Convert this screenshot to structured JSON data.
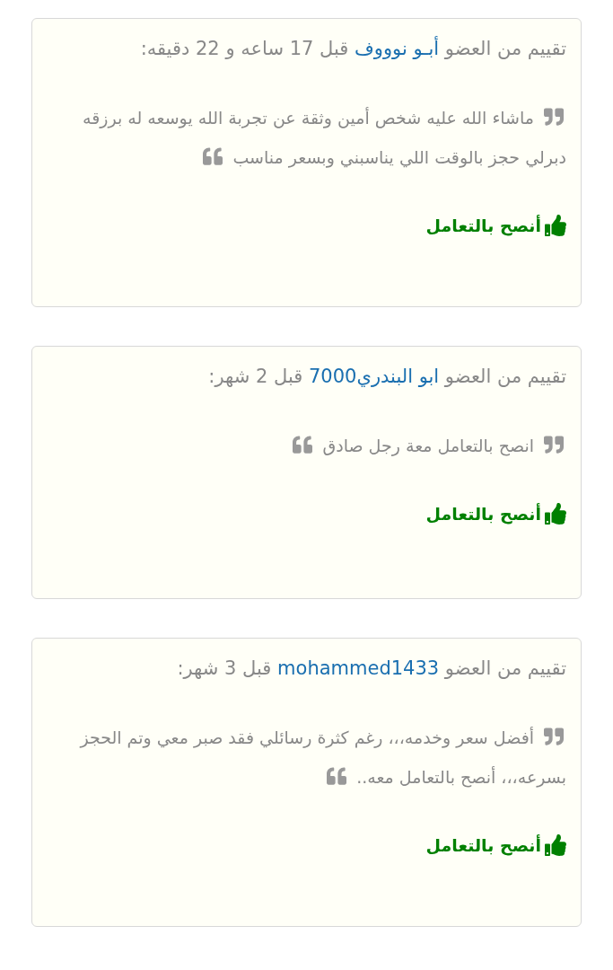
{
  "reviews": [
    {
      "prefix": "تقييم من العضو",
      "member": "أبـو نوووف",
      "suffix": "قبل 17 ساعه و 22 دقيقه:",
      "comment": "ماشاء الله عليه شخص أمين وثقة عن تجربة الله يوسعه له برزقه دبرلي حجز بالوقت اللي يناسبني وبسعر مناسب",
      "rating": {
        "kind": "positive",
        "label": "أنصح بالتعامل"
      }
    },
    {
      "prefix": "تقييم من العضو",
      "member": "ابو البندري7000",
      "suffix": "قبل 2 شهر:",
      "comment": "انصح بالتعامل معة رجل صادق",
      "rating": {
        "kind": "positive",
        "label": "أنصح بالتعامل"
      }
    },
    {
      "prefix": "تقييم من العضو",
      "member": "mohammed1433",
      "suffix": "قبل 3 شهر:",
      "comment": "أفضل سعر وخدمه،،، رغم كثرة رسائلي فقد صبر معي وتم الحجز بسرعه،،، أنصح بالتعامل معه..",
      "rating": {
        "kind": "positive",
        "label": "أنصح بالتعامل"
      }
    }
  ]
}
